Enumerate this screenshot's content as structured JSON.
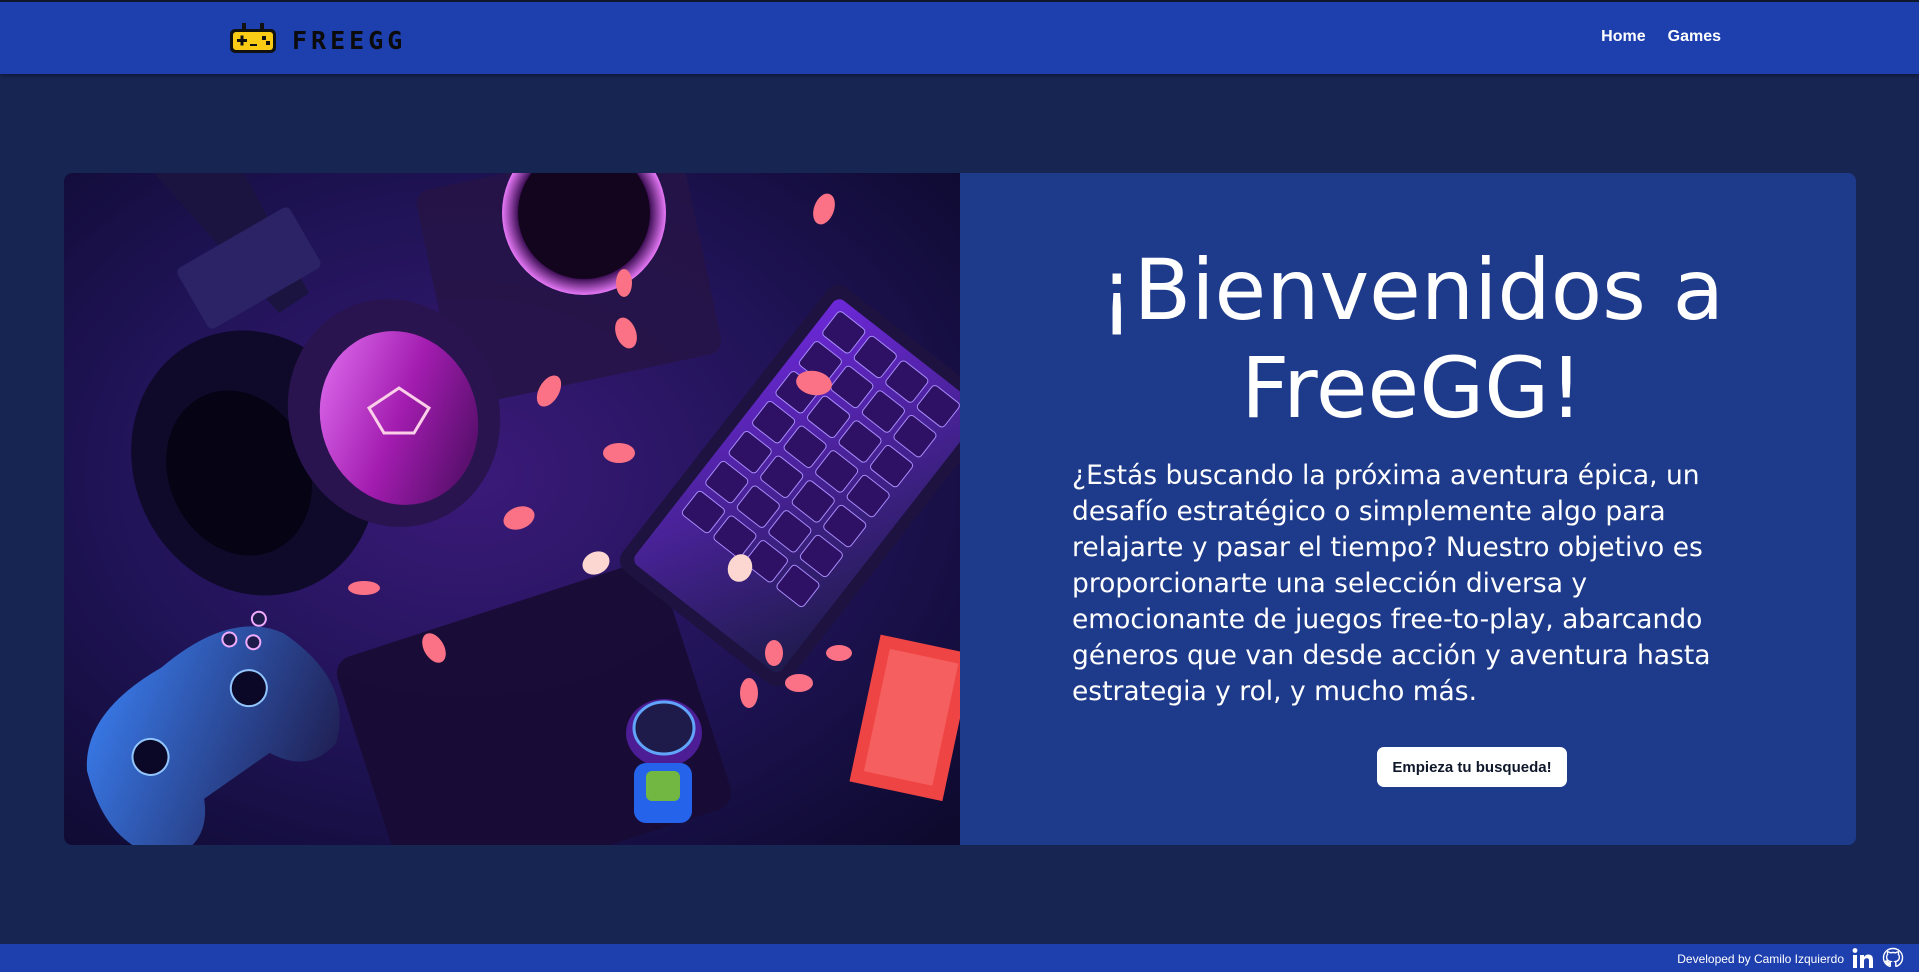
{
  "header": {
    "logo_text": "FREEGG",
    "logo_icon": "gamepad-icon",
    "nav": [
      {
        "label": "Home"
      },
      {
        "label": "Games"
      }
    ]
  },
  "hero": {
    "title": "¡Bienvenidos a FreeGG!",
    "description": "¿Estás buscando la próxima aventura épica, un desafío estratégico o simplemente algo para relajarte y pasar el tiempo? Nuestro objetivo es proporcionarte una selección diversa y emocionante de juegos free-to-play, abarcando géneros que van desde acción y aventura hasta estrategia y rol, y mucho más.",
    "cta_label": "Empieza tu busqueda!",
    "image_icon": "gaming-setup-photo"
  },
  "footer": {
    "credit": "Developed by Camilo Izquierdo",
    "icons": [
      "linkedin-icon",
      "github-icon"
    ]
  },
  "colors": {
    "page_background": "#172553",
    "header_background": "#1e40af",
    "card_background": "#1e3a8a",
    "button_background": "#ffffff"
  }
}
